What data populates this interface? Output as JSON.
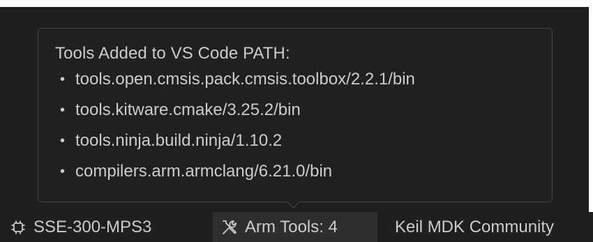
{
  "tooltip": {
    "title": "Tools Added to VS Code PATH:",
    "bullet": "•",
    "items": [
      "tools.open.cmsis.pack.cmsis.toolbox/2.2.1/bin",
      "tools.kitware.cmake/3.25.2/bin",
      "tools.ninja.build.ninja/1.10.2",
      "compilers.arm.armclang/6.21.0/bin"
    ]
  },
  "status_bar": {
    "board": {
      "icon": "chip-icon",
      "label": "SSE-300-MPS3"
    },
    "tools": {
      "icon": "tools-icon",
      "label": "Arm Tools: 4"
    },
    "toolchain": {
      "label": "Keil MDK Community"
    }
  },
  "colors": {
    "background": "#1f1f1f",
    "tooltip_bg": "#202020",
    "tooltip_border": "#454545",
    "text": "#cccccc",
    "active_status_item": "#2e2e2e"
  }
}
